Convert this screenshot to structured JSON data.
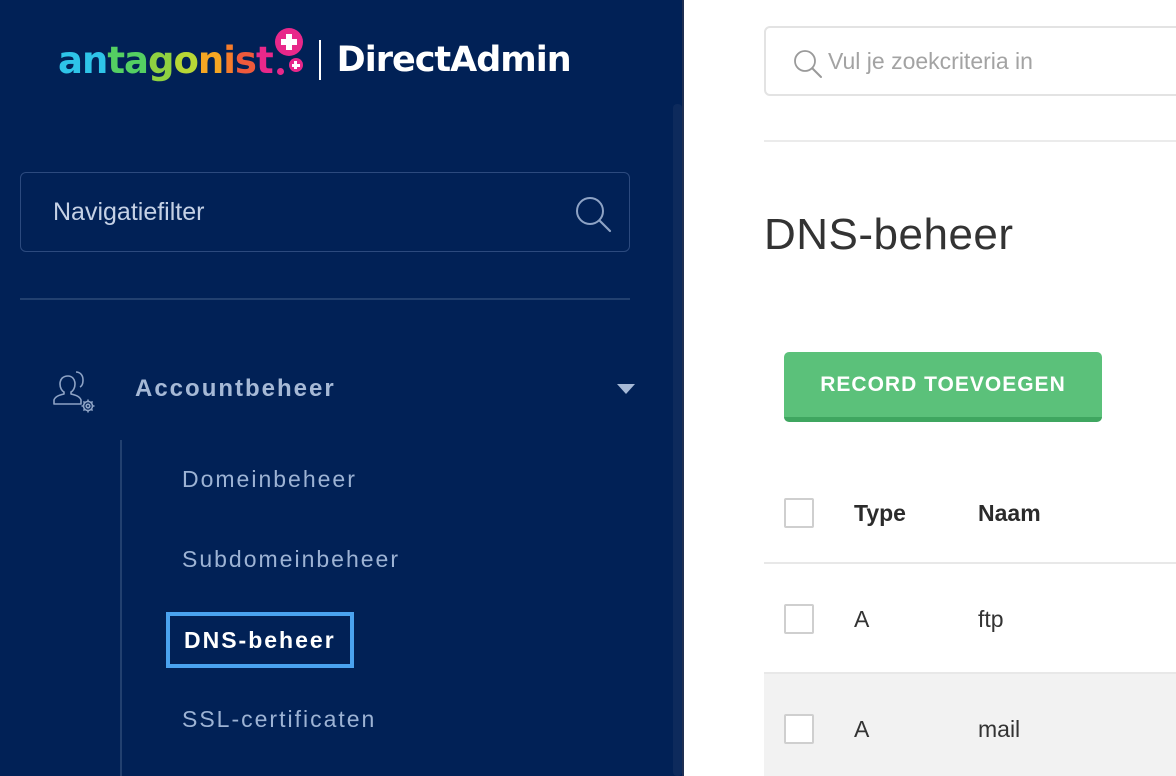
{
  "logo": {
    "brand_letters": [
      "a",
      "n",
      "t",
      "a",
      "g",
      "o",
      "n",
      "i",
      "s",
      "t"
    ],
    "brand_colors": [
      "#2ec4e8",
      "#2ec4e8",
      "#54cf62",
      "#54cf62",
      "#8fd141",
      "#b7d736",
      "#f5a623",
      "#f57c2b",
      "#ef5a3c",
      "#e8288a"
    ],
    "product": "DirectAdmin"
  },
  "sidebar": {
    "filter_placeholder": "Navigatiefilter",
    "section": {
      "label": "Accountbeheer"
    },
    "items": [
      {
        "label": "Domeinbeheer"
      },
      {
        "label": "Subdomeinbeheer"
      },
      {
        "label": "DNS-beheer"
      },
      {
        "label": "SSL-certificaten"
      }
    ]
  },
  "main": {
    "search_placeholder": "Vul je zoekcriteria in",
    "title": "DNS-beheer",
    "add_button": "RECORD TOEVOEGEN",
    "table": {
      "columns": [
        "Type",
        "Naam"
      ],
      "rows": [
        {
          "type": "A",
          "name": "ftp"
        },
        {
          "type": "A",
          "name": "mail"
        }
      ]
    }
  },
  "colors": {
    "sidebar_bg": "#012156",
    "accent_green": "#5bc17a",
    "active_border": "#4aa3f0",
    "brand_pink": "#e8288a"
  }
}
